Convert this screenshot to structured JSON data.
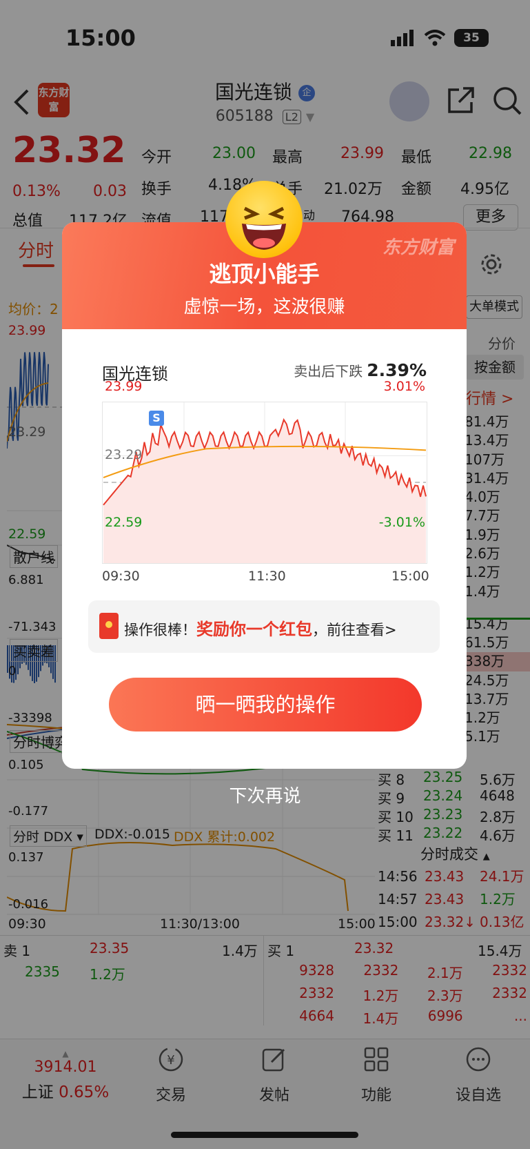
{
  "status": {
    "time": "15:00",
    "battery": "35"
  },
  "nav": {
    "logo": "东方财富",
    "title": "国光连锁",
    "code": "605188",
    "level": "L2"
  },
  "quote": {
    "price": "23.32",
    "change_pct": "0.13%",
    "change": "0.03",
    "open_label": "今开",
    "open": "23.00",
    "high_label": "最高",
    "high": "23.99",
    "low_label": "最低",
    "low": "22.98",
    "turnover_label": "换手",
    "turnover": "4.18%",
    "volume_label": "总手",
    "volume": "21.02万",
    "amount_label": "金额",
    "amount": "4.95亿",
    "mktcap_label": "总值",
    "mktcap": "117.2亿",
    "float_label": "流值",
    "float": "117",
    "extra_label": "动",
    "extra": "764.98",
    "more": "更多"
  },
  "tabs": {
    "active": "分时",
    "avg_label": "均价：2"
  },
  "right_panel": {
    "mode": "大单模式",
    "per_price": "分价",
    "by_amount": "按金额",
    "market": "行情 >",
    "vol_list": [
      "81.4万",
      "13.4万",
      "107万",
      "31.4万",
      "4.0万",
      "7.7万",
      "1.9万",
      "2.6万",
      "1.2万",
      "1.4万",
      "15.4万",
      "61.5万",
      "338万",
      "24.5万",
      "13.7万",
      "1.2万",
      "5.1万"
    ],
    "bids": [
      {
        "label": "买 8",
        "price": "23.25",
        "vol": "5.6万"
      },
      {
        "label": "买 9",
        "price": "23.24",
        "vol": "4648"
      },
      {
        "label": "买 10",
        "price": "23.23",
        "vol": "2.8万"
      },
      {
        "label": "买 11",
        "price": "23.22",
        "vol": "4.6万"
      }
    ],
    "ticks_title": "分时成交",
    "ticks": [
      {
        "time": "14:56",
        "price": "23.43",
        "vol": "24.1万"
      },
      {
        "time": "14:57",
        "price": "23.43",
        "vol": "1.2万"
      },
      {
        "time": "15:00",
        "price": "23.32↓",
        "vol": "0.13亿"
      }
    ]
  },
  "left_charts": {
    "price_hi": "23.99",
    "price_mid": "23.29",
    "price_lo": "22.59",
    "retail_label": "散户线",
    "retail_val": "6.881",
    "retail_lo": "-71.343",
    "bs_label": "买卖差",
    "bs_zero": "0",
    "bs_lo": "-33398",
    "game_label": "分时博弈",
    "game_hi": "0.105",
    "game_lo": "-0.177",
    "ddx_label": "分时 DDX ▾",
    "ddx_val": "DDX:-0.015",
    "ddx_sum": "DDX 累计:0.002",
    "ddx_hi": "0.137",
    "ddx_lo": "-0.016",
    "t_start": "09:30",
    "t_mid": "11:30/13:00",
    "t_end": "15:00"
  },
  "orderbook": {
    "sell_label": "卖 1",
    "sell_price": "23.35",
    "sell_vol": "1.4万",
    "buy_label": "买 1",
    "buy_price": "23.32",
    "buy_vol": "15.4万",
    "left_row": [
      "2335",
      "1.2万"
    ],
    "right_rows": [
      [
        "9328",
        "2332",
        "2.1万",
        "2332"
      ],
      [
        "2332",
        "1.2万",
        "2.3万",
        "2332"
      ],
      [
        "4664",
        "1.4万",
        "6996",
        "..."
      ]
    ]
  },
  "bottom_nav": {
    "index_value": "3914.01",
    "index_name": "上证",
    "index_pct": "0.65%",
    "trade": "交易",
    "post": "发帖",
    "func": "功能",
    "watch": "设自选"
  },
  "modal": {
    "watermark": "东方财富",
    "title": "逃顶小能手",
    "subtitle": "虚惊一场，这波很赚",
    "stock_name": "国光连锁",
    "drop_label": "卖出后下跌",
    "drop_value": "2.39%",
    "chart_hi": "23.99",
    "chart_mid": "23.29",
    "chart_lo": "22.59",
    "pct_hi": "3.01%",
    "pct_lo": "-3.01%",
    "t_start": "09:30",
    "t_mid": "11:30",
    "t_end": "15:00",
    "sell_marker": "S",
    "reward_prefix": "操作很棒！",
    "reward_highlight": "奖励你一个红包",
    "reward_suffix": "，前往查看>",
    "share_button": "晒一晒我的操作",
    "skip": "下次再说"
  },
  "colors": {
    "up": "#e02020",
    "down": "#1a9a1a",
    "brand": "#e4381f",
    "avg_line": "#f39c12"
  }
}
